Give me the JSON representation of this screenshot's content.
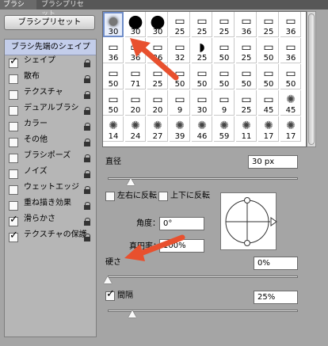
{
  "tabs": [
    {
      "label": "ブラシ",
      "active": true
    },
    {
      "label": "ブラシプリセット",
      "active": false
    }
  ],
  "preset_button": "ブラシプリセット",
  "sidebar": {
    "header": "ブラシ先端のシェイプ",
    "items": [
      {
        "label": "シェイプ",
        "checked": true
      },
      {
        "label": "散布",
        "checked": false
      },
      {
        "label": "テクスチャ",
        "checked": false
      },
      {
        "label": "デュアルブラシ",
        "checked": false
      },
      {
        "label": "カラー",
        "checked": false
      },
      {
        "label": "その他",
        "checked": false
      },
      {
        "label": "ブラシポーズ",
        "checked": false
      },
      {
        "label": "ノイズ",
        "checked": false
      },
      {
        "label": "ウェットエッジ",
        "checked": false
      },
      {
        "label": "重ね描き効果",
        "checked": false
      },
      {
        "label": "滑らかさ",
        "checked": true
      },
      {
        "label": "テクスチャの保護",
        "checked": true
      }
    ]
  },
  "brush_grid": {
    "selected_index": 0,
    "rows": [
      [
        "30",
        "30",
        "30",
        "25",
        "25",
        "25",
        "36",
        "25",
        "36"
      ],
      [
        "36",
        "36",
        "36",
        "32",
        "25",
        "50",
        "25",
        "50",
        "36"
      ],
      [
        "50",
        "71",
        "25",
        "50",
        "50",
        "50",
        "50",
        "50",
        "50"
      ],
      [
        "50",
        "20",
        "20",
        "9",
        "30",
        "9",
        "25",
        "45",
        "45"
      ],
      [
        "14",
        "24",
        "27",
        "39",
        "46",
        "59",
        "11",
        "17",
        "17"
      ]
    ]
  },
  "diameter": {
    "label": "直径",
    "value": "30 px",
    "slider_fraction": 0.12
  },
  "flip_x": {
    "label": "左右に反転",
    "checked": false
  },
  "flip_y": {
    "label": "上下に反転",
    "checked": false
  },
  "angle": {
    "label": "角度：",
    "value": "0°"
  },
  "roundness": {
    "label": "真円率：",
    "value": "100%"
  },
  "hardness": {
    "label": "硬さ",
    "value": "0%",
    "slider_fraction": 0.0
  },
  "spacing": {
    "label": "間隔",
    "value": "25%",
    "slider_fraction": 0.13,
    "checked": true
  },
  "colors": {
    "annotation_arrow": "#e8502e",
    "selection": "#6e8cc8"
  }
}
